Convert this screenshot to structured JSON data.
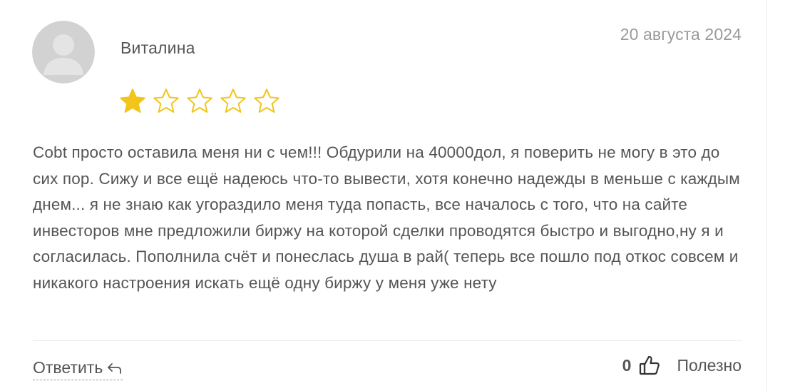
{
  "review": {
    "author": "Виталина",
    "date": "20 августа 2024",
    "rating": 1,
    "rating_max": 5,
    "text": "Cobt просто оставила меня ни с чем!!! Обдурили на 40000дол, я поверить не могу в это до сих пор. Сижу и все ещё надеюсь что-то вывести, хотя конечно надежды в меньше с каждым днем... я не знаю как угораздило меня туда попасть, все началось с того, что на сайте инвесторов мне предложили биржу на которой сделки проводятся быстро и выгодно,ну я и согласилась. Пополнила счёт и понеслась душа в рай( теперь все пошло под откос совсем и никакого настроения искать ещё одну биржу у меня уже нету"
  },
  "actions": {
    "reply_label": "Ответить",
    "useful_count": "0",
    "useful_label": "Полезно"
  },
  "icons": {
    "avatar": "default-user-avatar",
    "star_filled": "star-filled-icon",
    "star_empty": "star-outline-icon",
    "reply": "reply-arrow-icon",
    "like": "thumbs-up-icon"
  },
  "colors": {
    "star": "#f2c518",
    "text": "#555555",
    "muted": "#9a9a9a",
    "divider": "#ececec"
  }
}
